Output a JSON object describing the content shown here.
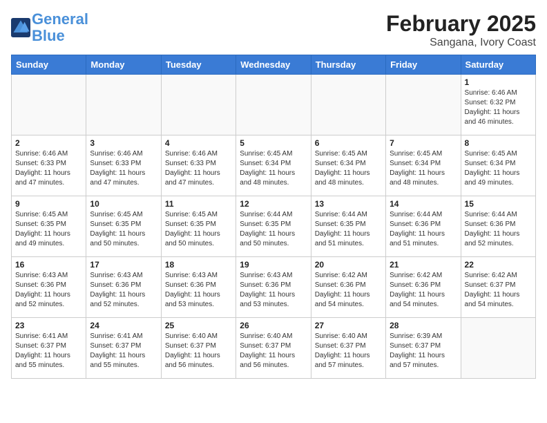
{
  "header": {
    "logo_line1": "General",
    "logo_line2": "Blue",
    "month": "February 2025",
    "location": "Sangana, Ivory Coast"
  },
  "weekdays": [
    "Sunday",
    "Monday",
    "Tuesday",
    "Wednesday",
    "Thursday",
    "Friday",
    "Saturday"
  ],
  "weeks": [
    [
      {
        "day": "",
        "info": ""
      },
      {
        "day": "",
        "info": ""
      },
      {
        "day": "",
        "info": ""
      },
      {
        "day": "",
        "info": ""
      },
      {
        "day": "",
        "info": ""
      },
      {
        "day": "",
        "info": ""
      },
      {
        "day": "1",
        "info": "Sunrise: 6:46 AM\nSunset: 6:32 PM\nDaylight: 11 hours and 46 minutes."
      }
    ],
    [
      {
        "day": "2",
        "info": "Sunrise: 6:46 AM\nSunset: 6:33 PM\nDaylight: 11 hours and 47 minutes."
      },
      {
        "day": "3",
        "info": "Sunrise: 6:46 AM\nSunset: 6:33 PM\nDaylight: 11 hours and 47 minutes."
      },
      {
        "day": "4",
        "info": "Sunrise: 6:46 AM\nSunset: 6:33 PM\nDaylight: 11 hours and 47 minutes."
      },
      {
        "day": "5",
        "info": "Sunrise: 6:45 AM\nSunset: 6:34 PM\nDaylight: 11 hours and 48 minutes."
      },
      {
        "day": "6",
        "info": "Sunrise: 6:45 AM\nSunset: 6:34 PM\nDaylight: 11 hours and 48 minutes."
      },
      {
        "day": "7",
        "info": "Sunrise: 6:45 AM\nSunset: 6:34 PM\nDaylight: 11 hours and 48 minutes."
      },
      {
        "day": "8",
        "info": "Sunrise: 6:45 AM\nSunset: 6:34 PM\nDaylight: 11 hours and 49 minutes."
      }
    ],
    [
      {
        "day": "9",
        "info": "Sunrise: 6:45 AM\nSunset: 6:35 PM\nDaylight: 11 hours and 49 minutes."
      },
      {
        "day": "10",
        "info": "Sunrise: 6:45 AM\nSunset: 6:35 PM\nDaylight: 11 hours and 50 minutes."
      },
      {
        "day": "11",
        "info": "Sunrise: 6:45 AM\nSunset: 6:35 PM\nDaylight: 11 hours and 50 minutes."
      },
      {
        "day": "12",
        "info": "Sunrise: 6:44 AM\nSunset: 6:35 PM\nDaylight: 11 hours and 50 minutes."
      },
      {
        "day": "13",
        "info": "Sunrise: 6:44 AM\nSunset: 6:35 PM\nDaylight: 11 hours and 51 minutes."
      },
      {
        "day": "14",
        "info": "Sunrise: 6:44 AM\nSunset: 6:36 PM\nDaylight: 11 hours and 51 minutes."
      },
      {
        "day": "15",
        "info": "Sunrise: 6:44 AM\nSunset: 6:36 PM\nDaylight: 11 hours and 52 minutes."
      }
    ],
    [
      {
        "day": "16",
        "info": "Sunrise: 6:43 AM\nSunset: 6:36 PM\nDaylight: 11 hours and 52 minutes."
      },
      {
        "day": "17",
        "info": "Sunrise: 6:43 AM\nSunset: 6:36 PM\nDaylight: 11 hours and 52 minutes."
      },
      {
        "day": "18",
        "info": "Sunrise: 6:43 AM\nSunset: 6:36 PM\nDaylight: 11 hours and 53 minutes."
      },
      {
        "day": "19",
        "info": "Sunrise: 6:43 AM\nSunset: 6:36 PM\nDaylight: 11 hours and 53 minutes."
      },
      {
        "day": "20",
        "info": "Sunrise: 6:42 AM\nSunset: 6:36 PM\nDaylight: 11 hours and 54 minutes."
      },
      {
        "day": "21",
        "info": "Sunrise: 6:42 AM\nSunset: 6:36 PM\nDaylight: 11 hours and 54 minutes."
      },
      {
        "day": "22",
        "info": "Sunrise: 6:42 AM\nSunset: 6:37 PM\nDaylight: 11 hours and 54 minutes."
      }
    ],
    [
      {
        "day": "23",
        "info": "Sunrise: 6:41 AM\nSunset: 6:37 PM\nDaylight: 11 hours and 55 minutes."
      },
      {
        "day": "24",
        "info": "Sunrise: 6:41 AM\nSunset: 6:37 PM\nDaylight: 11 hours and 55 minutes."
      },
      {
        "day": "25",
        "info": "Sunrise: 6:40 AM\nSunset: 6:37 PM\nDaylight: 11 hours and 56 minutes."
      },
      {
        "day": "26",
        "info": "Sunrise: 6:40 AM\nSunset: 6:37 PM\nDaylight: 11 hours and 56 minutes."
      },
      {
        "day": "27",
        "info": "Sunrise: 6:40 AM\nSunset: 6:37 PM\nDaylight: 11 hours and 57 minutes."
      },
      {
        "day": "28",
        "info": "Sunrise: 6:39 AM\nSunset: 6:37 PM\nDaylight: 11 hours and 57 minutes."
      },
      {
        "day": "",
        "info": ""
      }
    ]
  ]
}
